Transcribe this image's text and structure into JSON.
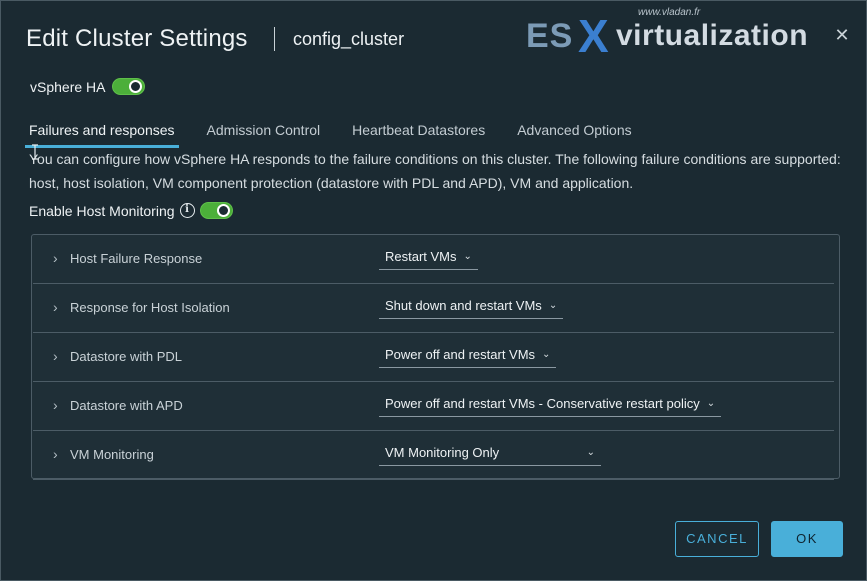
{
  "header": {
    "title": "Edit Cluster Settings",
    "subtitle": "config_cluster"
  },
  "watermark": {
    "url": "www.vladan.fr",
    "es": "ES",
    "x": "X",
    "virt": "virtualization"
  },
  "ha": {
    "label": "vSphere HA",
    "enabled": true
  },
  "tabs": [
    {
      "label": "Failures and responses",
      "active": true
    },
    {
      "label": "Admission Control",
      "active": false
    },
    {
      "label": "Heartbeat Datastores",
      "active": false
    },
    {
      "label": "Advanced Options",
      "active": false
    }
  ],
  "description": "You can configure how vSphere HA responds to the failure conditions on this cluster. The following failure conditions are supported: host, host isolation, VM component protection (datastore with PDL and APD), VM and application.",
  "host_monitoring": {
    "label": "Enable Host Monitoring",
    "enabled": true
  },
  "rows": [
    {
      "label": "Host Failure Response",
      "value": "Restart VMs"
    },
    {
      "label": "Response for Host Isolation",
      "value": "Shut down and restart VMs"
    },
    {
      "label": "Datastore with PDL",
      "value": "Power off and restart VMs"
    },
    {
      "label": "Datastore with APD",
      "value": "Power off and restart VMs - Conservative restart policy"
    },
    {
      "label": "VM Monitoring",
      "value": "VM Monitoring Only"
    }
  ],
  "buttons": {
    "cancel": "CANCEL",
    "ok": "OK"
  },
  "colors": {
    "background": "#1b2a32",
    "accent": "#49afd9",
    "toggle_on": "#4caf3a"
  }
}
